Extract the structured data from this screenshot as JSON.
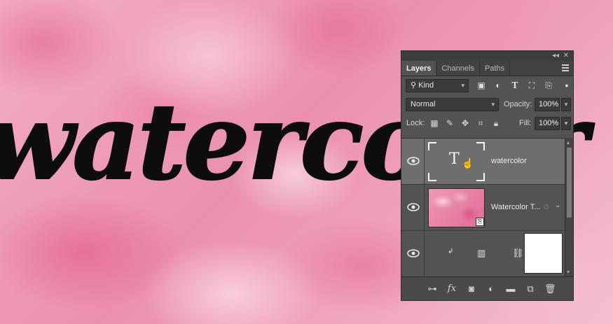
{
  "canvas": {
    "text": "watercolor"
  },
  "panel": {
    "tabs": [
      {
        "label": "Layers",
        "active": true
      },
      {
        "label": "Channels",
        "active": false
      },
      {
        "label": "Paths",
        "active": false
      }
    ],
    "filter": {
      "value": "Kind"
    },
    "blend_mode": {
      "value": "Normal"
    },
    "opacity": {
      "label": "Opacity:",
      "value": "100%"
    },
    "lock_label": "Lock:",
    "fill": {
      "label": "Fill:",
      "value": "100%"
    },
    "layers": [
      {
        "name": "watercolor",
        "kind": "type",
        "selected": true
      },
      {
        "name": "Watercolor T...",
        "kind": "smart-object",
        "selected": false
      },
      {
        "name": "",
        "kind": "adjustment",
        "selected": false
      }
    ],
    "bottom_icons": [
      "link-icon",
      "fx-icon",
      "mask-icon",
      "adjustment-icon",
      "folder-icon",
      "new-layer-icon",
      "trash-icon"
    ]
  }
}
